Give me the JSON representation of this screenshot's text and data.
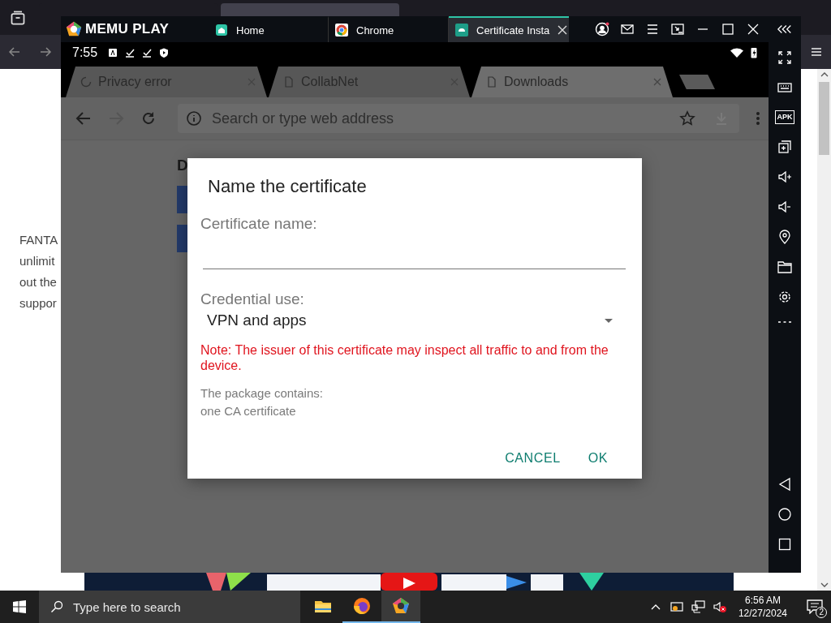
{
  "background_browser": {
    "page_text": [
      "FANTA",
      "unlimit",
      "out the",
      "suppor"
    ]
  },
  "emulator": {
    "logo": "MEMU PLAY",
    "tabs": [
      {
        "label": "Home",
        "selected": false
      },
      {
        "label": "Chrome",
        "selected": false
      },
      {
        "label": "Certificate Insta",
        "selected": true
      }
    ],
    "sidebar": {
      "apk_label": "APK"
    },
    "status_bar": {
      "time": "7:55"
    },
    "browser": {
      "tabs": [
        {
          "label": "Privacy error",
          "loading": true,
          "selected": false
        },
        {
          "label": "CollabNet",
          "loading": false,
          "selected": false
        },
        {
          "label": "Downloads",
          "loading": false,
          "selected": true
        }
      ],
      "address_placeholder": "Search or type web address",
      "page": {
        "heading": "D"
      }
    },
    "dialog": {
      "title": "Name the certificate",
      "name_field": {
        "label": "Certificate name:"
      },
      "credential_use": {
        "label": "Credential use:",
        "value": "VPN and apps"
      },
      "warning": "Note: The issuer of this certificate may inspect all traffic to and from the device.",
      "package_info": [
        "The package contains:",
        "one CA certificate"
      ],
      "buttons": [
        "CANCEL",
        "OK"
      ]
    }
  },
  "taskbar": {
    "search_placeholder": "Type here to search",
    "apps": [
      {
        "kind": "explorer",
        "active": false
      },
      {
        "kind": "firefox",
        "active": true
      },
      {
        "kind": "memu",
        "active": true
      }
    ],
    "time": "6:56 AM",
    "date": "12/27/2024",
    "notification_count": "2"
  }
}
